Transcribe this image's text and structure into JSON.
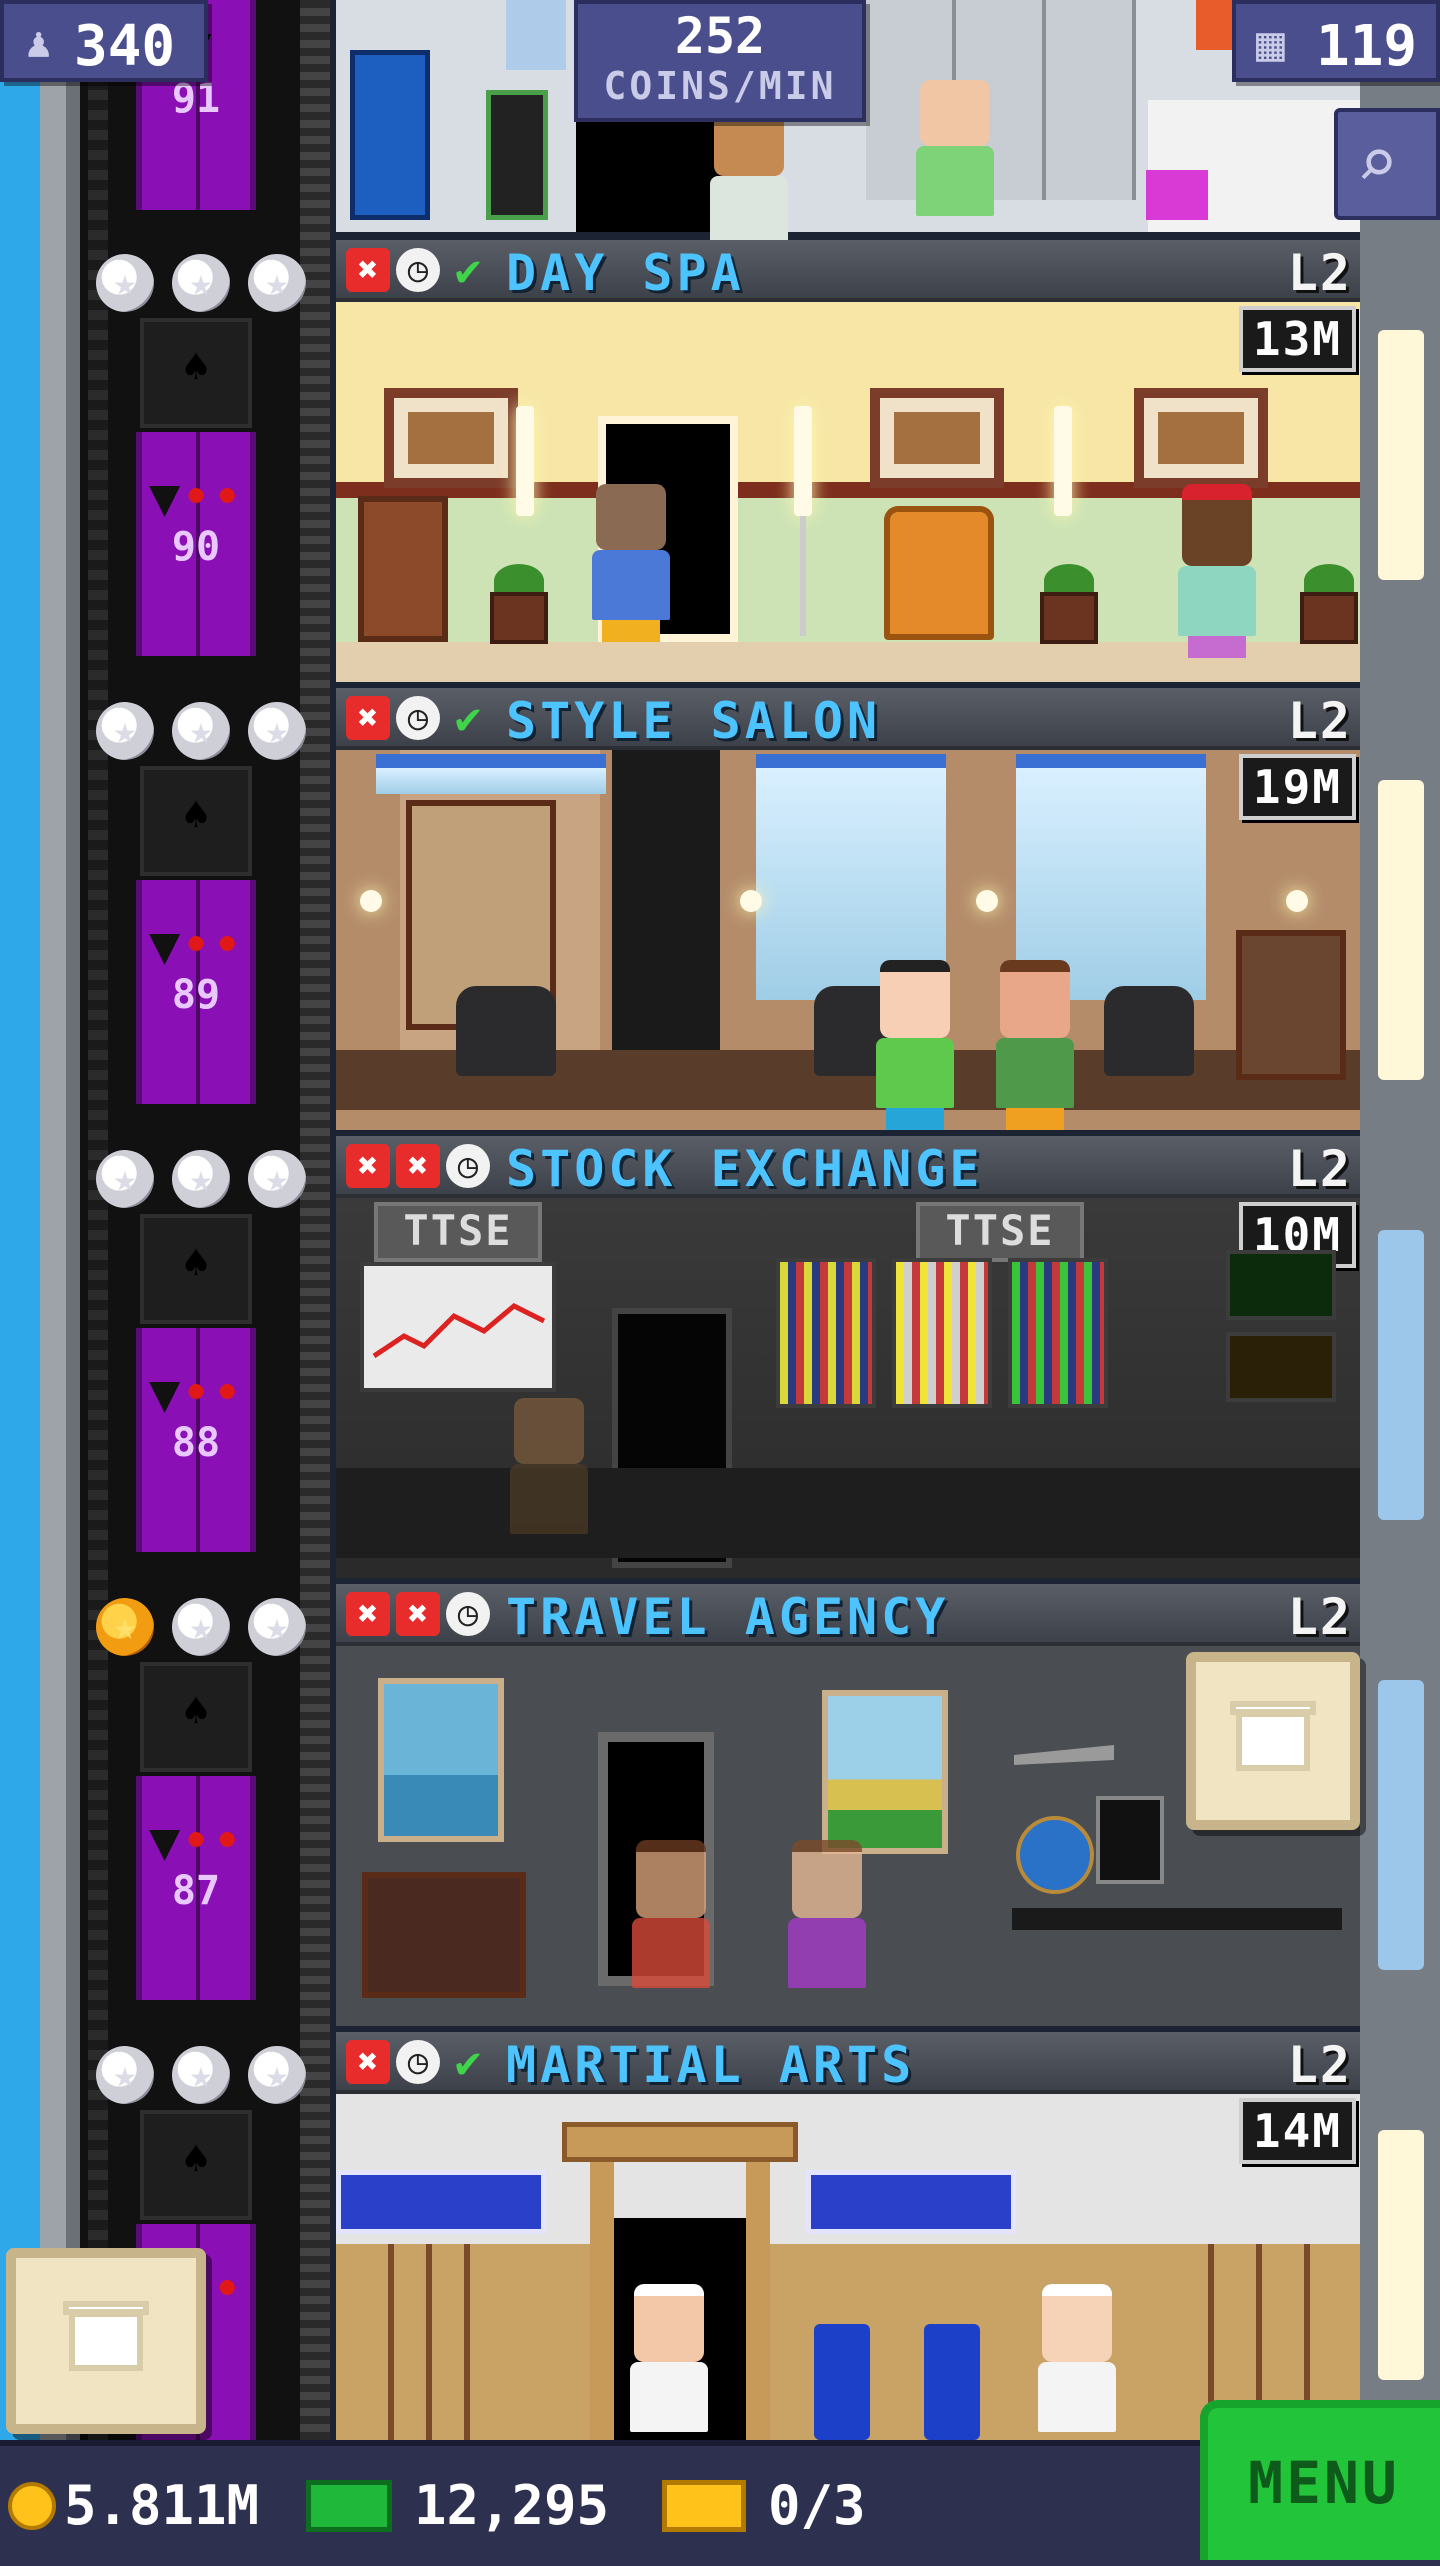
{
  "hud": {
    "population": "340",
    "coin_rate": "252",
    "coin_rate_unit": "COINS/MIN",
    "bux": "119"
  },
  "floors": [
    {
      "number": "90",
      "name": "DAY SPA",
      "level": "L2",
      "price": "13M",
      "stars": [
        false,
        false,
        false
      ],
      "status": [
        "x",
        "clock",
        "check"
      ]
    },
    {
      "number": "89",
      "name": "STYLE SALON",
      "level": "L2",
      "price": "19M",
      "stars": [
        false,
        false,
        false
      ],
      "status": [
        "x",
        "clock",
        "check"
      ]
    },
    {
      "number": "88",
      "name": "STOCK EXCHANGE",
      "level": "L2",
      "price": "10M",
      "stars": [
        false,
        false,
        false
      ],
      "status": [
        "x",
        "x",
        "clock"
      ],
      "signs": [
        "TTSE",
        "TTSE"
      ]
    },
    {
      "number": "87",
      "name": "TRAVEL AGENCY",
      "level": "L2",
      "price": "",
      "stars": [
        true,
        false,
        false
      ],
      "status": [
        "x",
        "x",
        "clock"
      ]
    },
    {
      "number": "",
      "name": "MARTIAL ARTS",
      "level": "L2",
      "price": "14M",
      "stars": [
        false,
        false,
        false
      ],
      "status": [
        "x",
        "clock",
        "check"
      ]
    }
  ],
  "top_floor_number": "91",
  "bottom_bar": {
    "coins": "5.811M",
    "bux": "12,295",
    "tickets": "0/3",
    "menu_label": "MENU"
  },
  "colors": {
    "elevator_door": "#8a0fb5",
    "floor_name": "#4dc3ff",
    "menu_button": "#22c43a",
    "hud_box": "#4a4e8c"
  },
  "icons": {
    "population": "person-icon",
    "bux_hud": "building-icon",
    "search": "magnifier-icon",
    "coin": "coin-icon",
    "bux": "bux-bill-icon",
    "ticket": "ticket-icon",
    "crate": "crate-icon"
  }
}
